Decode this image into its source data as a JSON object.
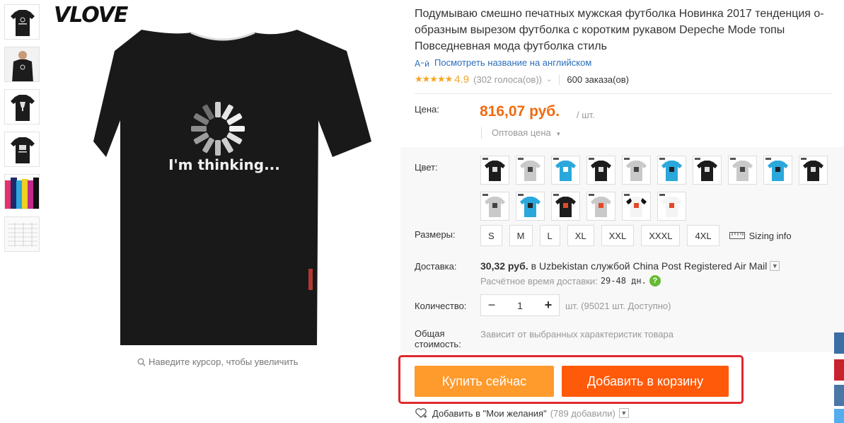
{
  "brand": {
    "logo_text": "VLOVE"
  },
  "product_image": {
    "print_text": "I'm thinking..."
  },
  "zoom_hint": "Наведите курсор, чтобы увеличить",
  "product": {
    "title": "Подумываю смешно печатных мужская футболка Новинка 2017 тенденция о-образным вырезом футболка с коротким рукавом Depeche Mode топы Повседневная мода футболка стиль",
    "translate_link": "Посмотреть название на английском",
    "rating_stars": "★★★★★",
    "rating": "4.9",
    "votes": "(302 голоса(ов))",
    "orders": "600 заказа(ов)"
  },
  "price": {
    "label": "Цена:",
    "value": "816,07 руб.",
    "unit": "/ шт.",
    "wholesale": "Оптовая цена"
  },
  "color": {
    "label": "Цвет:",
    "swatches": [
      {
        "name": "black-loading",
        "shirt": "#1c1c1c",
        "print": "#ddd"
      },
      {
        "name": "grey-loading",
        "shirt": "#c9c9c9",
        "print": "#444"
      },
      {
        "name": "sky-blue-loading",
        "shirt": "#2aa8dc",
        "print": "#fff"
      },
      {
        "name": "black-glass",
        "shirt": "#1c1c1c",
        "print": "#ddd"
      },
      {
        "name": "grey-glass",
        "shirt": "#c9c9c9",
        "print": "#444"
      },
      {
        "name": "sky-blue-glass",
        "shirt": "#2aa8dc",
        "print": "#222"
      },
      {
        "name": "black-beer",
        "shirt": "#1c1c1c",
        "print": "#ddd"
      },
      {
        "name": "grey-beer",
        "shirt": "#c9c9c9",
        "print": "#444"
      },
      {
        "name": "sky-blue-beer",
        "shirt": "#2aa8dc",
        "print": "#222"
      },
      {
        "name": "black-beer-2",
        "shirt": "#1c1c1c",
        "print": "#ddd"
      },
      {
        "name": "grey-print",
        "shirt": "#c9c9c9",
        "print": "#444"
      },
      {
        "name": "sky-blue-print",
        "shirt": "#2aa8dc",
        "print": "#222"
      },
      {
        "name": "black-red-print",
        "shirt": "#1c1c1c",
        "print": "#e04a2a"
      },
      {
        "name": "grey-red-print",
        "shirt": "#c9c9c9",
        "print": "#e04a2a"
      },
      {
        "name": "raglan-red-print",
        "shirt": "#f4f4f4",
        "print": "#e04a2a",
        "raglan": "#111"
      },
      {
        "name": "white-red-print",
        "shirt": "#f4f4f4",
        "print": "#e04a2a"
      }
    ]
  },
  "sizes": {
    "label": "Размеры:",
    "options": [
      "S",
      "M",
      "L",
      "XL",
      "XXL",
      "XXXL",
      "4XL"
    ],
    "sizing_info": "Sizing info"
  },
  "shipping": {
    "label": "Доставка:",
    "cost": "30,32 руб.",
    "route": "в Uzbekistan службой China Post Registered Air Mail",
    "time_label": "Расчётное время доставки:",
    "time_value": "29-48 дн.",
    "help": "?"
  },
  "quantity": {
    "label": "Количество:",
    "minus": "−",
    "value": "1",
    "plus": "+",
    "available": "шт. (95021 шт. Доступно)"
  },
  "total": {
    "label_line1": "Общая",
    "label_line2": "стоимость:",
    "note": "Зависит от выбранных характеристик товара"
  },
  "actions": {
    "buy_now": "Купить сейчас",
    "add_to_cart": "Добавить в корзину"
  },
  "wishlist": {
    "text": "Добавить в \"Мои желания\"",
    "count": "(789 добавили)"
  },
  "colors": {
    "accent": "#f06a0f",
    "buy_btn": "#ff9a2c",
    "cart_btn": "#ff5a0a",
    "link": "#2a6ebb",
    "highlight": "#e0282f"
  },
  "social": [
    {
      "name": "vk-share",
      "color": "#3c6ea6"
    },
    {
      "name": "pinterest-share",
      "color": "#c8232c"
    },
    {
      "name": "vk-share-2",
      "color": "#4a76a8"
    },
    {
      "name": "twitter-share",
      "color": "#55acee"
    }
  ]
}
